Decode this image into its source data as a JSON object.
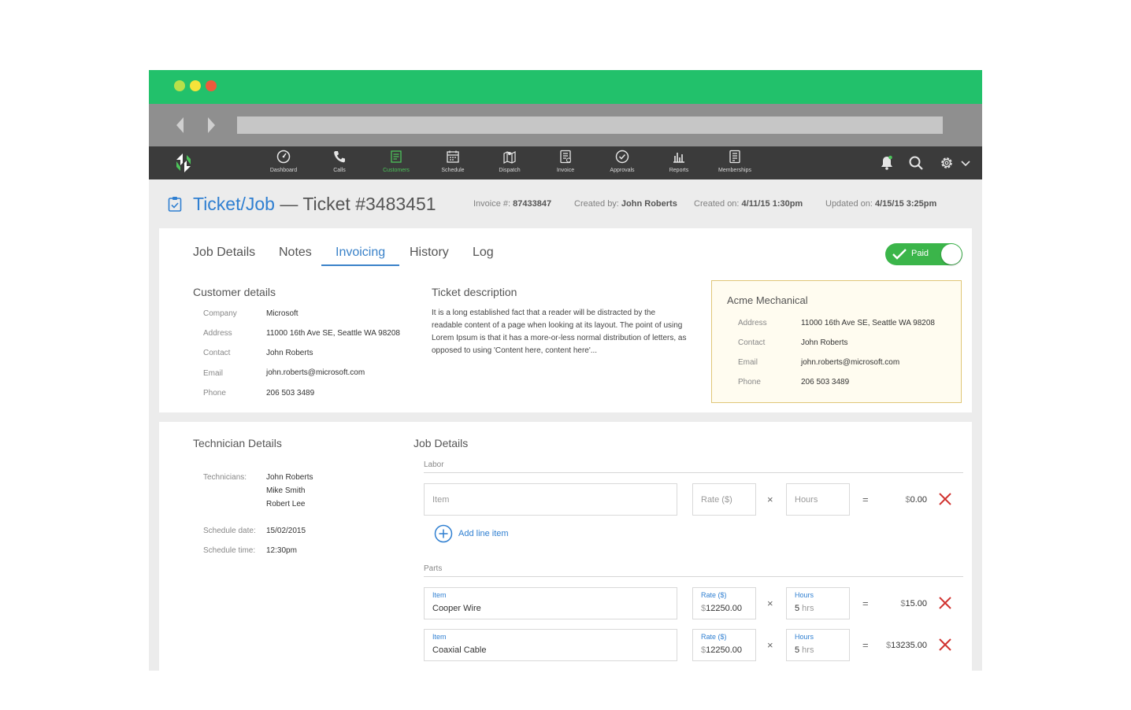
{
  "nav": {
    "items": [
      {
        "label": "Dashboard",
        "icon": "dashboard-icon"
      },
      {
        "label": "Calls",
        "icon": "phone-icon"
      },
      {
        "label": "Customers",
        "icon": "customers-icon"
      },
      {
        "label": "Schedule",
        "icon": "calendar-icon"
      },
      {
        "label": "Dispatch",
        "icon": "map-icon"
      },
      {
        "label": "Invoice",
        "icon": "invoice-icon"
      },
      {
        "label": "Approvals",
        "icon": "check-circle-icon"
      },
      {
        "label": "Reports",
        "icon": "bar-chart-icon"
      },
      {
        "label": "Memberships",
        "icon": "memberships-icon"
      }
    ],
    "active": "Customers",
    "active_color": "#4cc35a"
  },
  "header": {
    "title_link": "Ticket/Job",
    "title_rest": " — Ticket #3483451",
    "invoice_label": "Invoice #: ",
    "invoice_value": "87433847",
    "created_by_label": "Created by: ",
    "created_by_value": "John Roberts",
    "created_on_label": "Created on: ",
    "created_on_value": "4/11/15 1:30pm",
    "updated_on_label": "Updated on: ",
    "updated_on_value": "4/15/15 3:25pm"
  },
  "tabs": [
    "Job Details",
    "Notes",
    "Invoicing",
    "History",
    "Log"
  ],
  "active_tab": "Invoicing",
  "paid_toggle": {
    "label": "Paid",
    "on": true
  },
  "customer": {
    "title": "Customer details",
    "company_label": "Company",
    "company": "Microsoft",
    "address_label": "Address",
    "address": "11000 16th Ave SE, Seattle WA 98208",
    "contact_label": "Contact",
    "contact": "John Roberts",
    "email_label": "Email",
    "email": "john.roberts@microsoft.com",
    "phone_label": "Phone",
    "phone": "206 503 3489"
  },
  "ticket": {
    "title": "Ticket description",
    "description": "It is a long established fact that a reader will be distracted by the readable content of a page when looking at its layout. The point of using Lorem Ipsum is that it has a more-or-less normal distribution of letters, as opposed to using 'Content here, content here'..."
  },
  "acme": {
    "title": "Acme Mechanical",
    "address_label": "Address",
    "address": "11000 16th Ave SE, Seattle WA 98208",
    "contact_label": "Contact",
    "contact": "John Roberts",
    "email_label": "Email",
    "email": "john.roberts@microsoft.com",
    "phone_label": "Phone",
    "phone": "206 503 3489"
  },
  "technician": {
    "title": "Technician Details",
    "technicians_label": "Technicians:",
    "technicians": [
      "John Roberts",
      "Mike Smith",
      "Robert Lee"
    ],
    "schedule_date_label": "Schedule date:",
    "schedule_date": "15/02/2015",
    "schedule_time_label": "Schedule time:",
    "schedule_time": "12:30pm"
  },
  "job": {
    "title": "Job Details",
    "labor_label": "Labor",
    "labor": {
      "item_placeholder": "Item",
      "rate_placeholder": "Rate ($)",
      "hours_placeholder": "Hours",
      "times": "×",
      "equals": "=",
      "currency": "$",
      "total": "0.00"
    },
    "add_line_label": "Add line item",
    "parts_label": "Parts",
    "parts": [
      {
        "item_label": "Item",
        "item": "Cooper Wire",
        "rate_label": "Rate ($)",
        "rate_cur": "$",
        "rate": "12250.00",
        "hours_label": "Hours",
        "hours": "5",
        "hours_unit": " hrs",
        "times": "×",
        "equals": "=",
        "currency": "$",
        "total": "15.00"
      },
      {
        "item_label": "Item",
        "item": "Coaxial Cable",
        "rate_label": "Rate ($)",
        "rate_cur": "$",
        "rate": "12250.00",
        "hours_label": "Hours",
        "hours": "5",
        "hours_unit": " hrs",
        "times": "×",
        "equals": "=",
        "currency": "$",
        "total": "13235.00"
      }
    ]
  },
  "colors": {
    "titlebar": "#22c16b",
    "link": "#2f7fd1",
    "paid": "#3bb54a",
    "delete": "#d0322f"
  }
}
